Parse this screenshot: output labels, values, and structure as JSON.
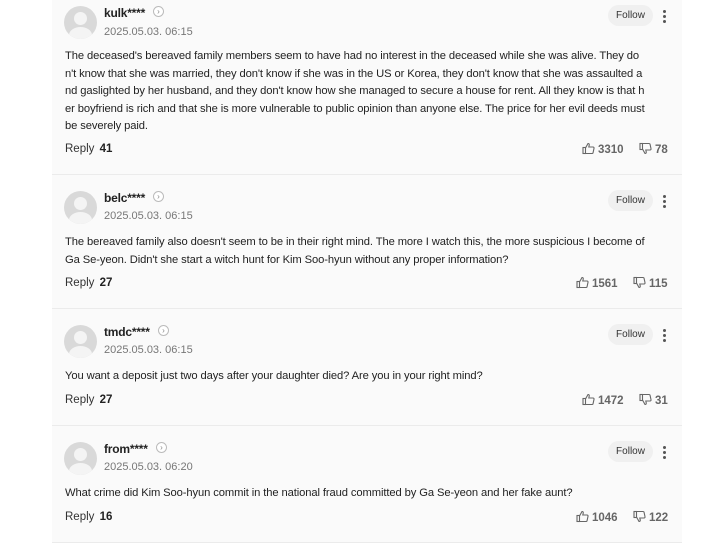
{
  "labels": {
    "follow": "Follow",
    "reply": "Reply"
  },
  "comments": [
    {
      "username": "kulk****",
      "date": "2025.05.03. 06:15",
      "body": [
        "The deceased's bereaved family members seem to have had no interest in the deceased while she was alive. They do",
        "n't know that she was married, they don't know if she was in the US or Korea, they don't know that she was assaulted a",
        "nd gaslighted by her husband, and they don't know how she managed to secure a house for rent. All they know is that h",
        "er boyfriend is rich and that she is more vulnerable to public opinion than anyone else. The price for her evil deeds must",
        "be severely paid."
      ],
      "replies": "41",
      "likes": "3310",
      "dislikes": "78"
    },
    {
      "username": "belc****",
      "date": "2025.05.03. 06:15",
      "body": [
        "The bereaved family also doesn't seem to be in their right mind. The more I watch this, the more suspicious I become of",
        "Ga Se-yeon. Didn't she start a witch hunt for Kim Soo-hyun without any proper information?"
      ],
      "replies": "27",
      "likes": "1561",
      "dislikes": "115"
    },
    {
      "username": "tmdc****",
      "date": "2025.05.03. 06:15",
      "body": [
        "You want a deposit just two days after your daughter died? Are you in your right mind?"
      ],
      "replies": "27",
      "likes": "1472",
      "dislikes": "31"
    },
    {
      "username": "from****",
      "date": "2025.05.03. 06:20",
      "body": [
        "What crime did Kim Soo-hyun commit in the national fraud committed by Ga Se-yeon and her fake aunt?"
      ],
      "replies": "16",
      "likes": "1046",
      "dislikes": "122"
    }
  ]
}
